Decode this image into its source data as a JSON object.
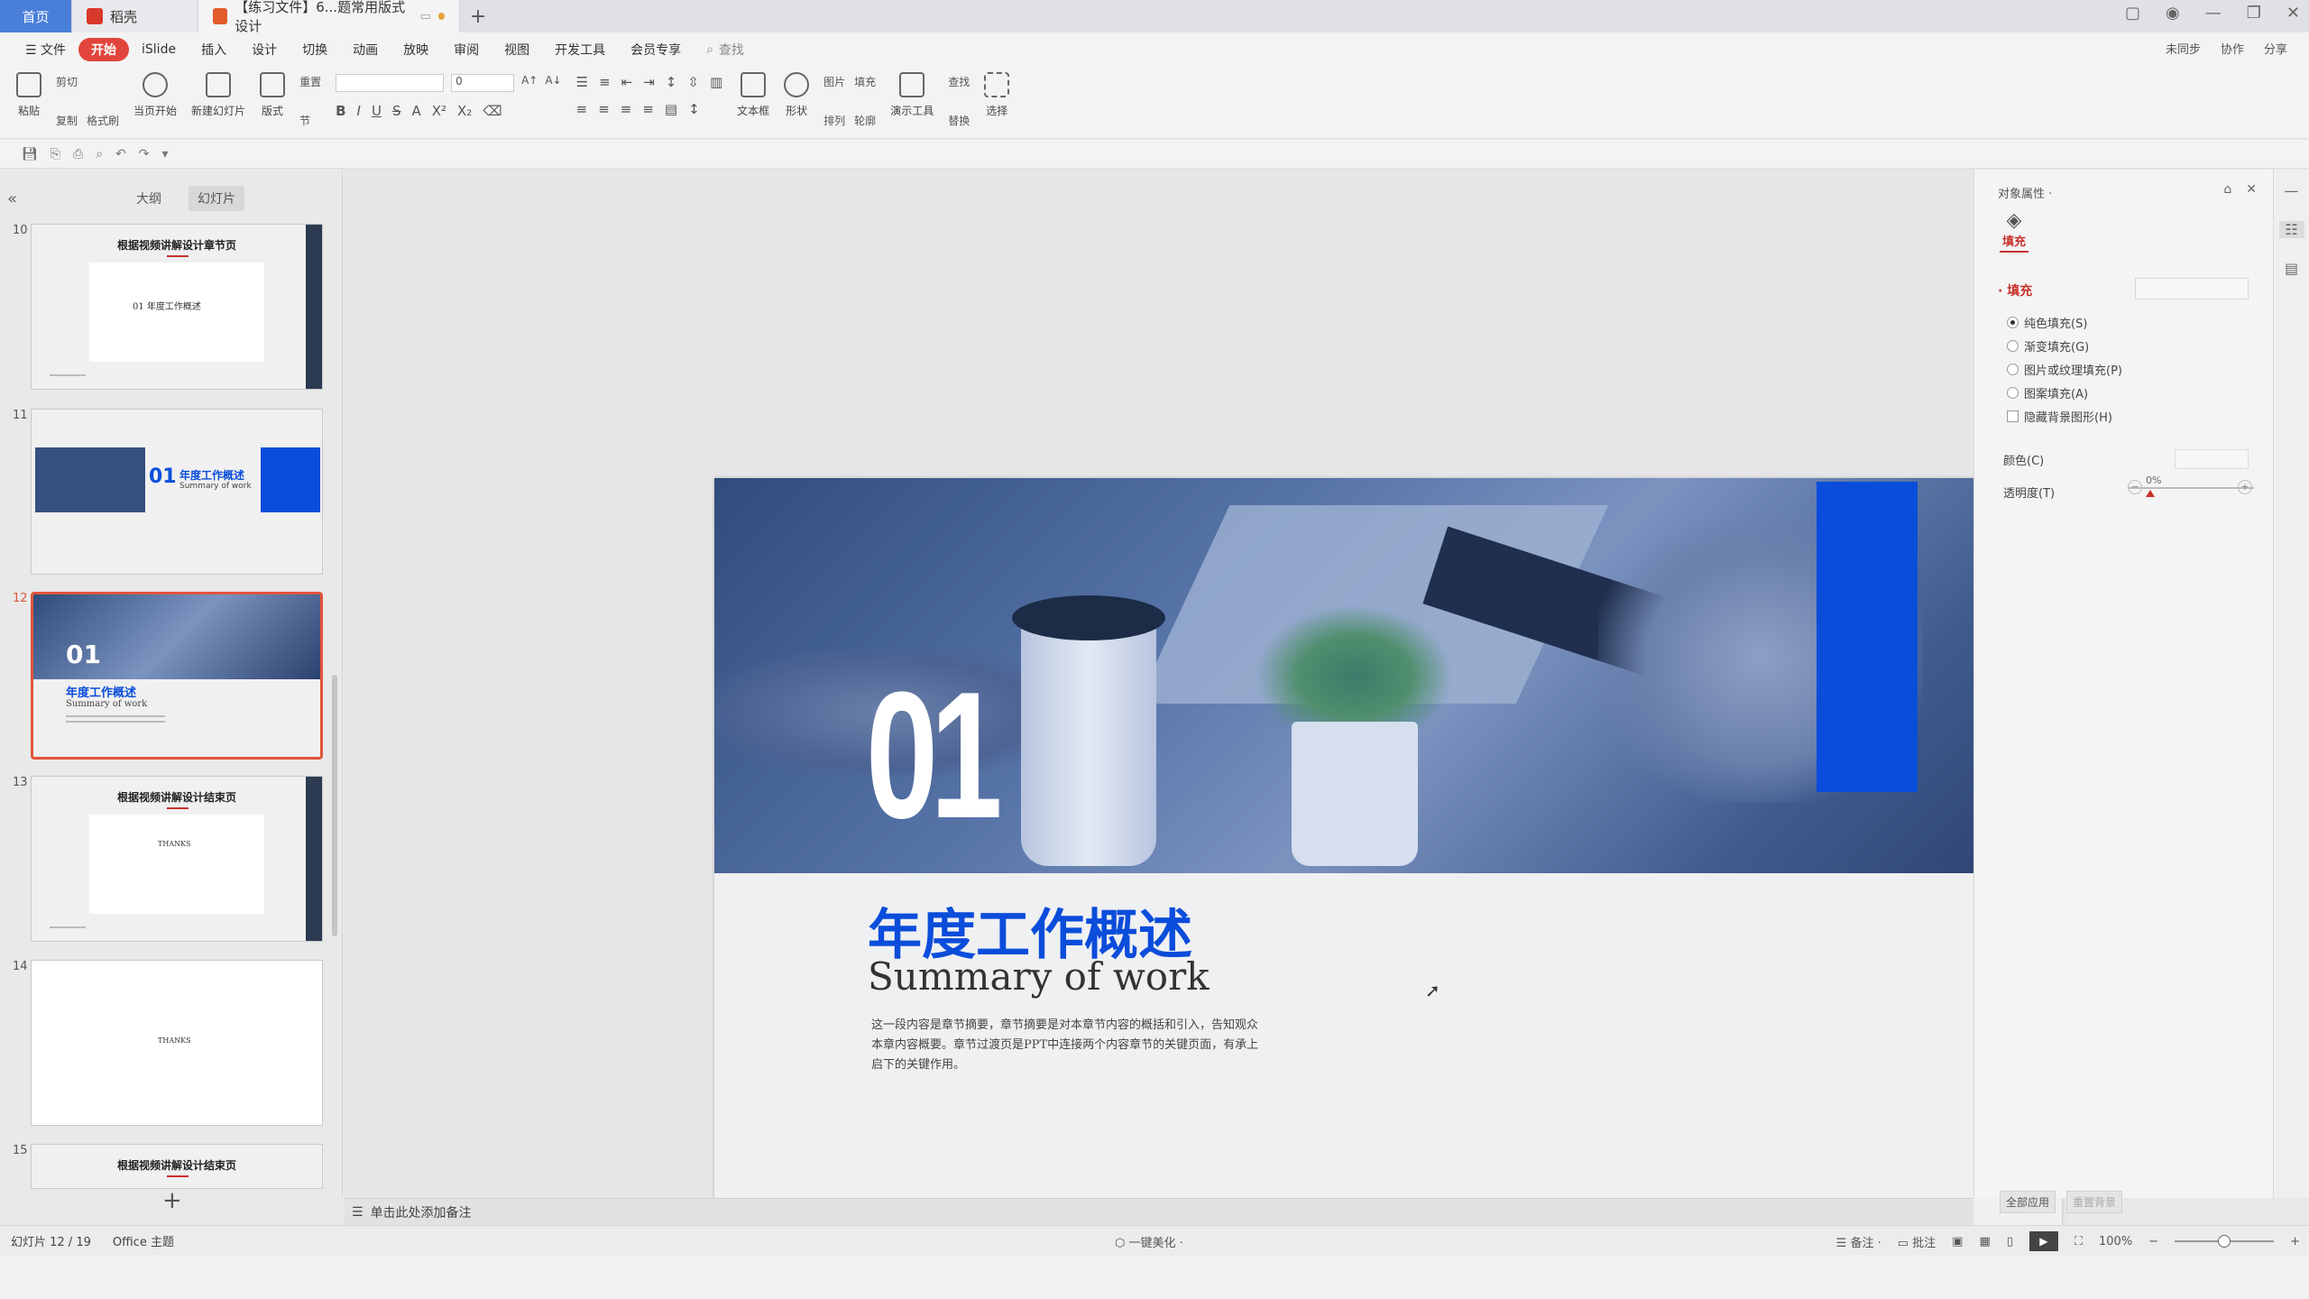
{
  "tabs": {
    "home": "首页",
    "doc1": "稻壳",
    "doc2": "【练习文件】6...题常用版式设计",
    "new": "+"
  },
  "menu": {
    "file": "☰ 文件",
    "items": [
      "开始",
      "iSlide",
      "插入",
      "设计",
      "切换",
      "动画",
      "放映",
      "审阅",
      "视图",
      "开发工具",
      "会员专享"
    ],
    "search": "查找",
    "right": [
      "未同步",
      "协作",
      "分享"
    ]
  },
  "ribbon": {
    "paste": "粘贴",
    "cut": "剪切",
    "copy": "复制",
    "format_painter": "格式刷",
    "play_from": "当页开始",
    "new_slide": "新建幻灯片",
    "layout": "版式",
    "reset": "重置",
    "section": "节",
    "font_size": "0",
    "textbox": "文本框",
    "shape": "形状",
    "picture": "图片",
    "fill": "填充",
    "arrange": "排列",
    "outline": "轮廓",
    "present_tool": "演示工具",
    "find": "查找",
    "replace": "替换",
    "select": "选择"
  },
  "left_panel": {
    "tab_outline": "大纲",
    "tab_slides": "幻灯片",
    "slides": [
      {
        "num": "10",
        "title": "根据视频讲解设计章节页",
        "sub": "01 年度工作概述"
      },
      {
        "num": "11",
        "big": "01",
        "title": "年度工作概述",
        "sub": "Summary of work"
      },
      {
        "num": "12",
        "big": "01",
        "title": "年度工作概述",
        "sub": "Summary of work"
      },
      {
        "num": "13",
        "title": "根据视频讲解设计结束页",
        "sub": "THANKS"
      },
      {
        "num": "14",
        "sub": "THANKS"
      },
      {
        "num": "15",
        "title": "根据视频讲解设计结束页"
      }
    ],
    "add": "+"
  },
  "slide": {
    "number": "01",
    "title_cn": "年度工作概述",
    "title_en": "Summary of work",
    "body": "这一段内容是章节摘要，章节摘要是对本章节内容的概括和引入，告知观众本章内容概要。章节过渡页是PPT中连接两个内容章节的关键页面，有承上启下的关键作用。"
  },
  "notes": {
    "placeholder": "单击此处添加备注"
  },
  "right_panel": {
    "title": "对象属性 ·",
    "fill_tab": "填充",
    "section": "· 填充",
    "options": [
      "纯色填充(S)",
      "渐变填充(G)",
      "图片或纹理填充(P)",
      "图案填充(A)"
    ],
    "hide_bg": "隐藏背景图形(H)",
    "color_label": "颜色(C)",
    "transparency_label": "透明度(T)",
    "transparency_value": "0%",
    "apply_all": "全部应用",
    "reset_bg": "重置背景"
  },
  "status": {
    "slide_pos": "幻灯片 12 / 19",
    "theme": "Office 主题",
    "beautify": "一键美化 ·",
    "notes": "备注 ·",
    "comments": "批注",
    "zoom": "100%"
  },
  "colors": {
    "accent_red": "#e2453c",
    "brand_blue": "#0b4ddb"
  }
}
